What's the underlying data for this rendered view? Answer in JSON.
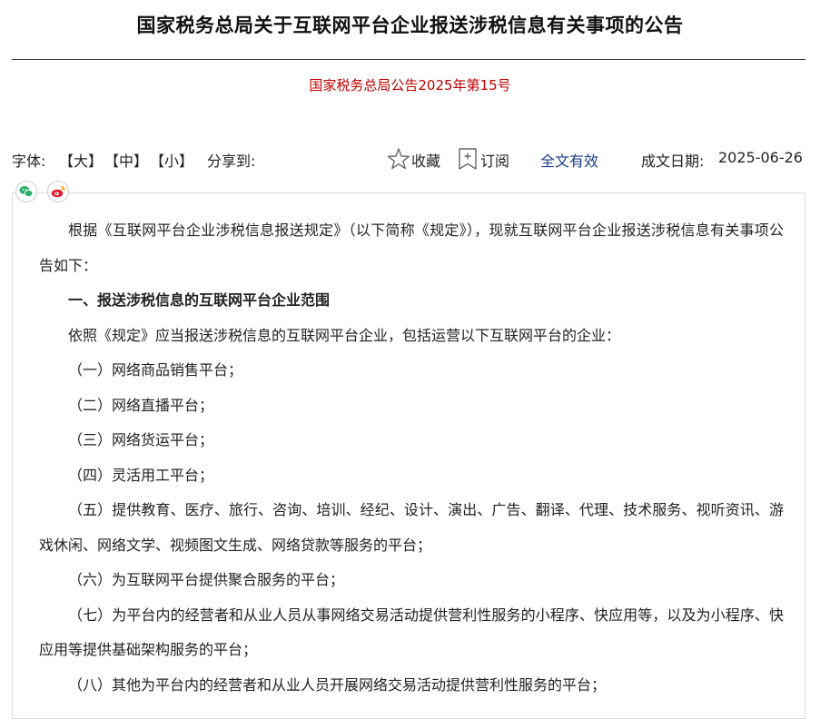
{
  "header": {
    "title": "国家税务总局关于互联网平台企业报送涉税信息有关事项的公告",
    "doc_number": "国家税务总局公告2025年第15号"
  },
  "toolbar": {
    "font_label": "字体:",
    "font_large": "【大】",
    "font_medium": "【中】",
    "font_small": "【小】",
    "share_label": "分享到:",
    "favorite_label": "收藏",
    "subscribe_label": "订阅",
    "validity": "全文有效",
    "date_label": "成文日期:",
    "date_value": "2025-06-26"
  },
  "share": {
    "wechat_icon": "wechat-icon",
    "weibo_icon": "weibo-icon",
    "wechat_color": "#2aae67",
    "weibo_color": "#e6162d"
  },
  "content": {
    "intro": "根据《互联网平台企业涉税信息报送规定》（以下简称《规定》），现就互联网平台企业报送涉税信息有关事项公告如下：",
    "section1_heading": "一、报送涉税信息的互联网平台企业范围",
    "section1_lead": "依照《规定》应当报送涉税信息的互联网平台企业，包括运营以下互联网平台的企业：",
    "items": [
      "（一）网络商品销售平台；",
      "（二）网络直播平台；",
      "（三）网络货运平台；",
      "（四）灵活用工平台；",
      "（五）提供教育、医疗、旅行、咨询、培训、经纪、设计、演出、广告、翻译、代理、技术服务、视听资讯、游戏休闲、网络文学、视频图文生成、网络贷款等服务的平台；",
      "（六）为互联网平台提供聚合服务的平台；",
      "（七）为平台内的经营者和从业人员从事网络交易活动提供营利性服务的小程序、快应用等，以及为小程序、快应用等提供基础架构服务的平台；",
      "（八）其他为平台内的经营者和从业人员开展网络交易活动提供营利性服务的平台；"
    ]
  },
  "colors": {
    "doc_number": "#c00000",
    "validity": "#1a3e8a"
  }
}
